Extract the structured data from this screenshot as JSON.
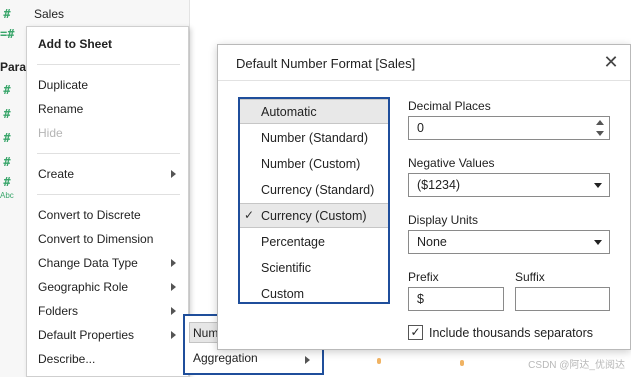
{
  "data_pane": {
    "sales_label": "Sales",
    "params_header": "Paran",
    "abc_badge": "Abc"
  },
  "context_menu": {
    "add_to_sheet": "Add to Sheet",
    "duplicate": "Duplicate",
    "rename": "Rename",
    "hide": "Hide",
    "create": "Create",
    "convert_discrete": "Convert to Discrete",
    "convert_dimension": "Convert to Dimension",
    "change_data_type": "Change Data Type",
    "geographic_role": "Geographic Role",
    "folders": "Folders",
    "default_properties": "Default Properties",
    "describe": "Describe..."
  },
  "submenu": {
    "number_format": "Number Format...",
    "aggregation": "Aggregation"
  },
  "dialog": {
    "title": "Default Number Format [Sales]",
    "close_glyph": "✕",
    "formats": [
      "Automatic",
      "Number (Standard)",
      "Number (Custom)",
      "Currency (Standard)",
      "Currency (Custom)",
      "Percentage",
      "Scientific",
      "Custom"
    ],
    "check_glyph": "✓",
    "decimal_places_label": "Decimal Places",
    "decimal_places_value": "0",
    "negative_values_label": "Negative Values",
    "negative_values_value": "($1234)",
    "display_units_label": "Display Units",
    "display_units_value": "None",
    "prefix_label": "Prefix",
    "prefix_value": "$",
    "suffix_label": "Suffix",
    "suffix_value": "",
    "thousands_label": "Include thousands separators",
    "thousands_checked": true,
    "check_mark": "✓"
  },
  "watermark": "CSDN @阿达_优阅达",
  "colors": {
    "accent_border": "#1f4e9b",
    "measure_green": "#3aa66b",
    "highlight_gray": "#e8e8e8"
  }
}
